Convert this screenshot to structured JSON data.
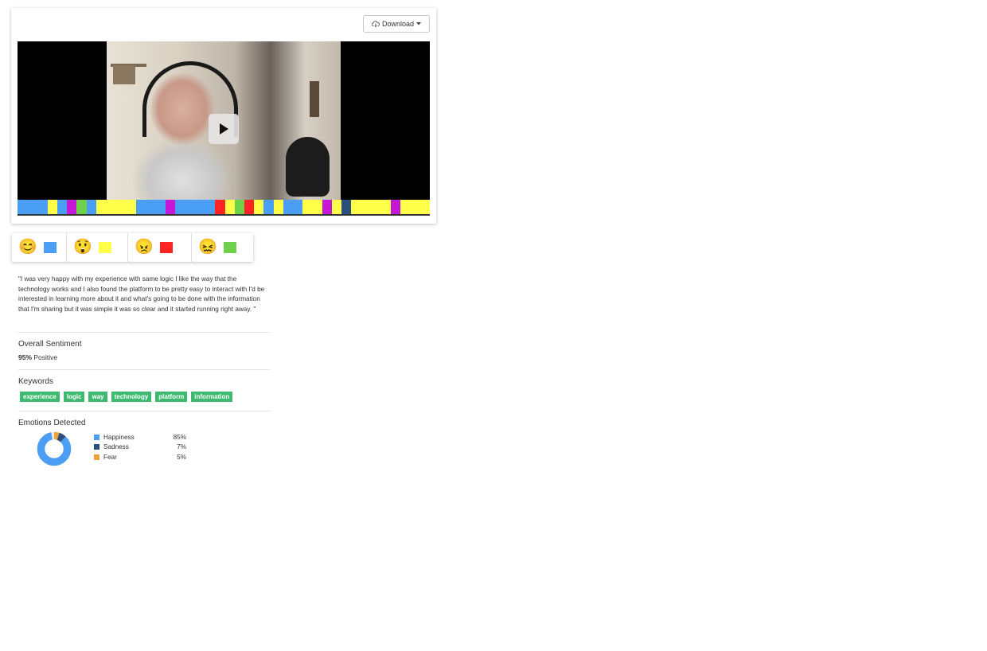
{
  "toolbar": {
    "download_label": "Download"
  },
  "video": {
    "play_icon": "play-icon",
    "timeline": [
      {
        "emotion": "happiness",
        "color": "#4a9ff5",
        "w": 37
      },
      {
        "emotion": "surprise",
        "color": "#ffff4a",
        "w": 12
      },
      {
        "emotion": "happiness",
        "color": "#4a9ff5",
        "w": 12
      },
      {
        "emotion": "contempt",
        "color": "#c418d6",
        "w": 12
      },
      {
        "emotion": "disgust",
        "color": "#6fd04a",
        "w": 12
      },
      {
        "emotion": "happiness",
        "color": "#4a9ff5",
        "w": 12
      },
      {
        "emotion": "surprise",
        "color": "#ffff4a",
        "w": 49
      },
      {
        "emotion": "happiness",
        "color": "#4a9ff5",
        "w": 37
      },
      {
        "emotion": "contempt",
        "color": "#c418d6",
        "w": 12
      },
      {
        "emotion": "happiness",
        "color": "#4a9ff5",
        "w": 49
      },
      {
        "emotion": "anger",
        "color": "#ff2323",
        "w": 12
      },
      {
        "emotion": "surprise",
        "color": "#ffff4a",
        "w": 12
      },
      {
        "emotion": "disgust",
        "color": "#6fd04a",
        "w": 12
      },
      {
        "emotion": "anger",
        "color": "#ff2323",
        "w": 12
      },
      {
        "emotion": "surprise",
        "color": "#ffff4a",
        "w": 12
      },
      {
        "emotion": "happiness",
        "color": "#4a9ff5",
        "w": 12
      },
      {
        "emotion": "surprise",
        "color": "#ffff4a",
        "w": 12
      },
      {
        "emotion": "happiness",
        "color": "#4a9ff5",
        "w": 24
      },
      {
        "emotion": "surprise",
        "color": "#ffff4a",
        "w": 24
      },
      {
        "emotion": "contempt",
        "color": "#c418d6",
        "w": 12
      },
      {
        "emotion": "surprise",
        "color": "#ffff4a",
        "w": 12
      },
      {
        "emotion": "sadness",
        "color": "#2d4f7c",
        "w": 12
      },
      {
        "emotion": "surprise",
        "color": "#ffff4a",
        "w": 49
      },
      {
        "emotion": "contempt",
        "color": "#c418d6",
        "w": 12
      },
      {
        "emotion": "surprise",
        "color": "#ffff4a",
        "w": 36
      }
    ]
  },
  "legend": [
    {
      "emoji": "😊",
      "icon": "smiling-face-icon",
      "color": "#4a9ff5",
      "width": 69
    },
    {
      "emoji": "😲",
      "icon": "astonished-face-icon",
      "color": "#ffff4a",
      "width": 77
    },
    {
      "emoji": "😠",
      "icon": "angry-face-icon",
      "color": "#ff2323",
      "width": 80
    },
    {
      "emoji": "😖",
      "icon": "confounded-face-icon",
      "color": "#6fd04a",
      "width": 77
    }
  ],
  "quote": "\"I was very happy with my experience with same logic I like the way that the technology works and I also found the platform to be pretty easy to interact with I'd be interested in learning more about it and what's going to be done with the information that I'm sharing but it was simple it was so clear and it started running right away. \"",
  "sentiment": {
    "heading": "Overall Sentiment",
    "percent": "95%",
    "label": "Positive"
  },
  "keywords": {
    "heading": "Keywords",
    "tags": [
      "experience",
      "logic",
      "way",
      "technology",
      "platform",
      "information"
    ]
  },
  "emotions": {
    "heading": "Emotions Detected",
    "items": [
      {
        "name": "Happiness",
        "pct": "85%",
        "value": 85,
        "color": "#4a9ff5"
      },
      {
        "name": "Sadness",
        "pct": "7%",
        "value": 7,
        "color": "#2d4f7c"
      },
      {
        "name": "Fear",
        "pct": "5%",
        "value": 5,
        "color": "#f0a13a"
      }
    ]
  }
}
